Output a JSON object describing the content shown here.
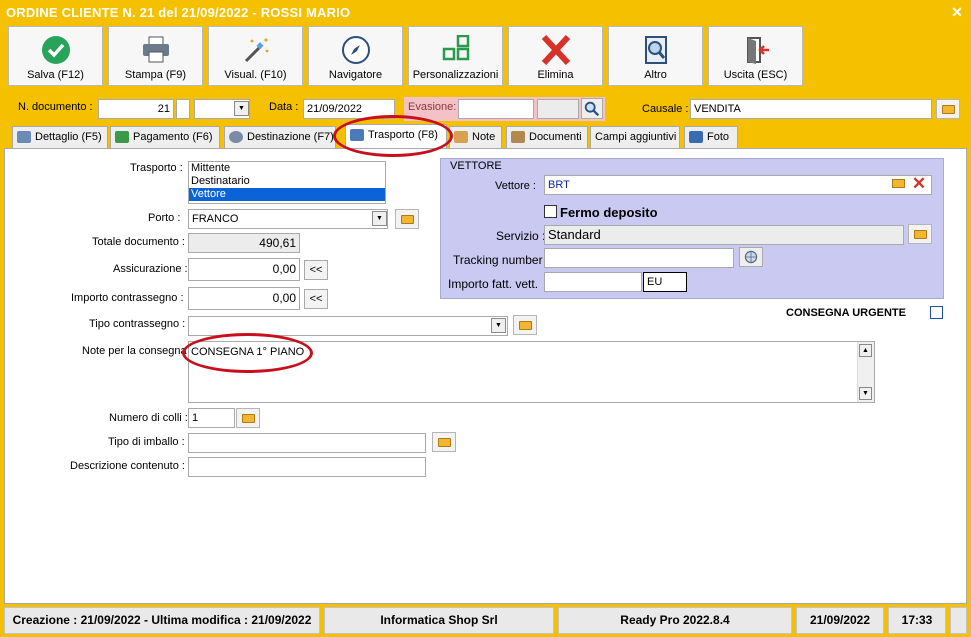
{
  "window": {
    "title": "ORDINE CLIENTE N. 21 del 21/09/2022 - ROSSI MARIO",
    "close": "✕"
  },
  "toolbar": [
    {
      "label": "Salva (F12)",
      "icon": "check-circle-icon"
    },
    {
      "label": "Stampa (F9)",
      "icon": "printer-icon"
    },
    {
      "label": "Visual. (F10)",
      "icon": "magic-wand-icon"
    },
    {
      "label": "Navigatore",
      "icon": "compass-icon"
    },
    {
      "label": "Personalizzazioni",
      "icon": "grid-icon"
    },
    {
      "label": "Elimina",
      "icon": "delete-x-icon"
    },
    {
      "label": "Altro",
      "icon": "search-doc-icon"
    },
    {
      "label": "Uscita (ESC)",
      "icon": "exit-door-icon"
    }
  ],
  "header": {
    "doc_label": "N. documento :",
    "doc_value": "21",
    "data_label": "Data :",
    "data_value": "21/09/2022",
    "evasione_label": "Evasione:",
    "causale_label": "Causale :",
    "causale_value": "VENDITA"
  },
  "tabs": [
    {
      "label": "Dettaglio (F5)",
      "active": false
    },
    {
      "label": "Pagamento (F6)",
      "active": false
    },
    {
      "label": "Destinazione (F7)",
      "active": false
    },
    {
      "label": "Trasporto (F8)",
      "active": true
    },
    {
      "label": "Note",
      "active": false
    },
    {
      "label": "Documenti",
      "active": false
    },
    {
      "label": "Campi aggiuntivi",
      "active": false
    },
    {
      "label": "Foto",
      "active": false
    }
  ],
  "trasporto": {
    "label": "Trasporto :",
    "options": [
      "Mittente",
      "Destinatario",
      "Vettore"
    ],
    "selected": "Vettore",
    "porto_label": "Porto :",
    "porto_value": "FRANCO",
    "totale_label": "Totale documento :",
    "totale_value": "490,61",
    "assicurazione_label": "Assicurazione :",
    "assicurazione_value": "0,00",
    "importo_contr_label": "Importo contrassegno :",
    "importo_contr_value": "0,00",
    "tipo_contr_label": "Tipo contrassegno :",
    "note_label": "Note per la consegna :",
    "note_value": "CONSEGNA 1° PIANO",
    "colli_label": "Numero di colli :",
    "colli_value": "1",
    "imballo_label": "Tipo di imballo :",
    "descrizione_label": "Descrizione contenuto :",
    "back_btn": "<<"
  },
  "vettore": {
    "group_title": "VETTORE",
    "vettore_label": "Vettore :",
    "vettore_value": "BRT",
    "fermo_label": "Fermo deposito",
    "servizio_label": "Servizio :",
    "servizio_value": "Standard",
    "tracking_label": "Tracking number :",
    "importo_label": "Importo fatt. vett.",
    "currency": "EU"
  },
  "urgent": {
    "label": "CONSEGNA URGENTE"
  },
  "status": {
    "dates": "Creazione : 21/09/2022 - Ultima modifica : 21/09/2022",
    "company": "Informatica Shop Srl",
    "version": "Ready Pro 2022.8.4",
    "date": "21/09/2022",
    "time": "17:33"
  },
  "colors": {
    "accent": "#f4c000",
    "vettore_bg": "#c9c9f2",
    "selection": "#0a64d8",
    "annotation": "#c8101c"
  }
}
